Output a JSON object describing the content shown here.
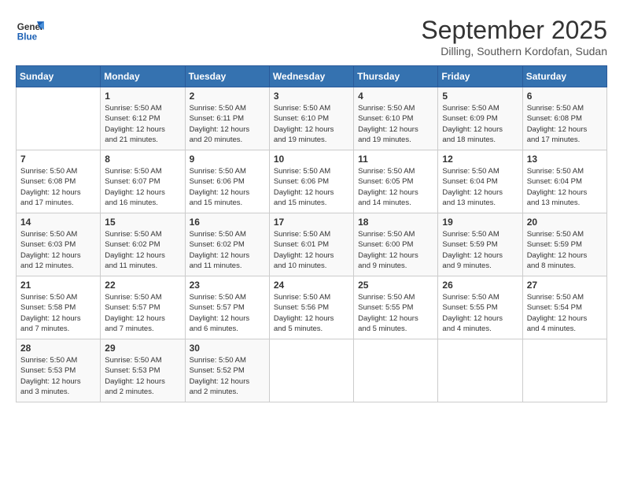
{
  "logo": {
    "line1": "General",
    "line2": "Blue"
  },
  "title": "September 2025",
  "subtitle": "Dilling, Southern Kordofan, Sudan",
  "weekdays": [
    "Sunday",
    "Monday",
    "Tuesday",
    "Wednesday",
    "Thursday",
    "Friday",
    "Saturday"
  ],
  "weeks": [
    [
      {
        "day": "",
        "info": ""
      },
      {
        "day": "1",
        "info": "Sunrise: 5:50 AM\nSunset: 6:12 PM\nDaylight: 12 hours\nand 21 minutes."
      },
      {
        "day": "2",
        "info": "Sunrise: 5:50 AM\nSunset: 6:11 PM\nDaylight: 12 hours\nand 20 minutes."
      },
      {
        "day": "3",
        "info": "Sunrise: 5:50 AM\nSunset: 6:10 PM\nDaylight: 12 hours\nand 19 minutes."
      },
      {
        "day": "4",
        "info": "Sunrise: 5:50 AM\nSunset: 6:10 PM\nDaylight: 12 hours\nand 19 minutes."
      },
      {
        "day": "5",
        "info": "Sunrise: 5:50 AM\nSunset: 6:09 PM\nDaylight: 12 hours\nand 18 minutes."
      },
      {
        "day": "6",
        "info": "Sunrise: 5:50 AM\nSunset: 6:08 PM\nDaylight: 12 hours\nand 17 minutes."
      }
    ],
    [
      {
        "day": "7",
        "info": "Sunrise: 5:50 AM\nSunset: 6:08 PM\nDaylight: 12 hours\nand 17 minutes."
      },
      {
        "day": "8",
        "info": "Sunrise: 5:50 AM\nSunset: 6:07 PM\nDaylight: 12 hours\nand 16 minutes."
      },
      {
        "day": "9",
        "info": "Sunrise: 5:50 AM\nSunset: 6:06 PM\nDaylight: 12 hours\nand 15 minutes."
      },
      {
        "day": "10",
        "info": "Sunrise: 5:50 AM\nSunset: 6:06 PM\nDaylight: 12 hours\nand 15 minutes."
      },
      {
        "day": "11",
        "info": "Sunrise: 5:50 AM\nSunset: 6:05 PM\nDaylight: 12 hours\nand 14 minutes."
      },
      {
        "day": "12",
        "info": "Sunrise: 5:50 AM\nSunset: 6:04 PM\nDaylight: 12 hours\nand 13 minutes."
      },
      {
        "day": "13",
        "info": "Sunrise: 5:50 AM\nSunset: 6:04 PM\nDaylight: 12 hours\nand 13 minutes."
      }
    ],
    [
      {
        "day": "14",
        "info": "Sunrise: 5:50 AM\nSunset: 6:03 PM\nDaylight: 12 hours\nand 12 minutes."
      },
      {
        "day": "15",
        "info": "Sunrise: 5:50 AM\nSunset: 6:02 PM\nDaylight: 12 hours\nand 11 minutes."
      },
      {
        "day": "16",
        "info": "Sunrise: 5:50 AM\nSunset: 6:02 PM\nDaylight: 12 hours\nand 11 minutes."
      },
      {
        "day": "17",
        "info": "Sunrise: 5:50 AM\nSunset: 6:01 PM\nDaylight: 12 hours\nand 10 minutes."
      },
      {
        "day": "18",
        "info": "Sunrise: 5:50 AM\nSunset: 6:00 PM\nDaylight: 12 hours\nand 9 minutes."
      },
      {
        "day": "19",
        "info": "Sunrise: 5:50 AM\nSunset: 5:59 PM\nDaylight: 12 hours\nand 9 minutes."
      },
      {
        "day": "20",
        "info": "Sunrise: 5:50 AM\nSunset: 5:59 PM\nDaylight: 12 hours\nand 8 minutes."
      }
    ],
    [
      {
        "day": "21",
        "info": "Sunrise: 5:50 AM\nSunset: 5:58 PM\nDaylight: 12 hours\nand 7 minutes."
      },
      {
        "day": "22",
        "info": "Sunrise: 5:50 AM\nSunset: 5:57 PM\nDaylight: 12 hours\nand 7 minutes."
      },
      {
        "day": "23",
        "info": "Sunrise: 5:50 AM\nSunset: 5:57 PM\nDaylight: 12 hours\nand 6 minutes."
      },
      {
        "day": "24",
        "info": "Sunrise: 5:50 AM\nSunset: 5:56 PM\nDaylight: 12 hours\nand 5 minutes."
      },
      {
        "day": "25",
        "info": "Sunrise: 5:50 AM\nSunset: 5:55 PM\nDaylight: 12 hours\nand 5 minutes."
      },
      {
        "day": "26",
        "info": "Sunrise: 5:50 AM\nSunset: 5:55 PM\nDaylight: 12 hours\nand 4 minutes."
      },
      {
        "day": "27",
        "info": "Sunrise: 5:50 AM\nSunset: 5:54 PM\nDaylight: 12 hours\nand 4 minutes."
      }
    ],
    [
      {
        "day": "28",
        "info": "Sunrise: 5:50 AM\nSunset: 5:53 PM\nDaylight: 12 hours\nand 3 minutes."
      },
      {
        "day": "29",
        "info": "Sunrise: 5:50 AM\nSunset: 5:53 PM\nDaylight: 12 hours\nand 2 minutes."
      },
      {
        "day": "30",
        "info": "Sunrise: 5:50 AM\nSunset: 5:52 PM\nDaylight: 12 hours\nand 2 minutes."
      },
      {
        "day": "",
        "info": ""
      },
      {
        "day": "",
        "info": ""
      },
      {
        "day": "",
        "info": ""
      },
      {
        "day": "",
        "info": ""
      }
    ]
  ]
}
